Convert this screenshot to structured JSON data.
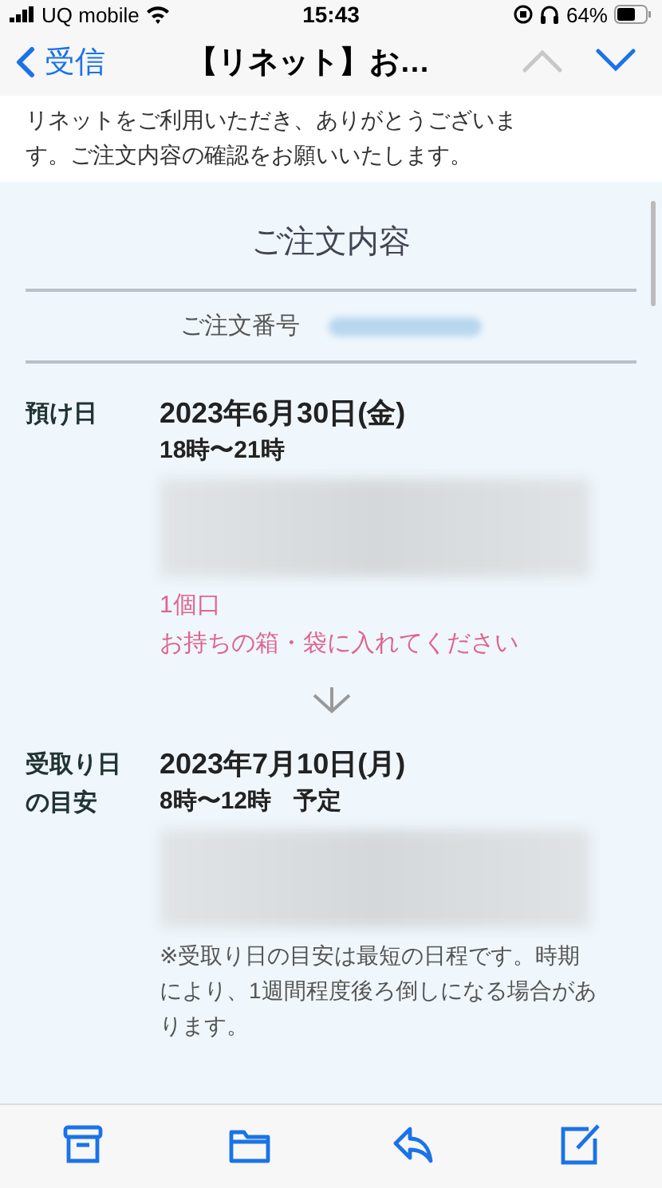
{
  "status_bar": {
    "carrier": "UQ mobile",
    "time": "15:43",
    "battery": "64%"
  },
  "nav": {
    "back_label": "受信",
    "title": "【リネット】お…"
  },
  "intro": [
    "リネットをご利用いただき、ありがとうございま",
    "す。ご注文内容の確認をお願いいたします。"
  ],
  "order": {
    "heading": "ご注文内容",
    "number_label": "ご注文番号",
    "number_redacted": true,
    "sections": [
      {
        "label": "預け日",
        "date": "2023年6月30日(金)",
        "time": "18時〜21時",
        "address_redacted": true,
        "notes": [
          {
            "text": "1個口",
            "kind": "alert"
          },
          {
            "text": "お持ちの箱・袋に入れてください",
            "kind": "alert"
          }
        ]
      },
      {
        "label": "受取り日の目安",
        "date": "2023年7月10日(月)",
        "time": "8時〜12時",
        "suffix": "予定",
        "address_redacted": true,
        "notes": [
          {
            "text": "※受取り日の目安は最短の日程です。時期により、1週間程度後ろ倒しになる場合があります。",
            "kind": "info"
          }
        ]
      }
    ]
  },
  "toolbar": [
    {
      "kind": "archive"
    },
    {
      "kind": "folder"
    },
    {
      "kind": "reply"
    },
    {
      "kind": "compose"
    }
  ]
}
